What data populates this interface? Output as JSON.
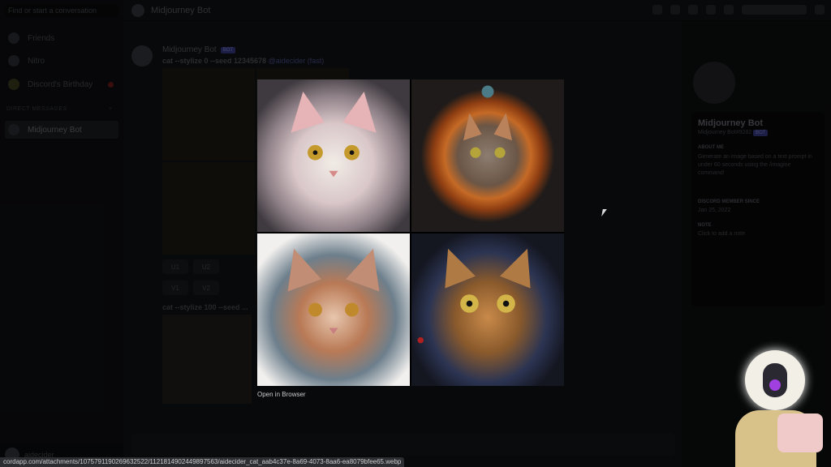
{
  "sidebar": {
    "search_placeholder": "Find or start a conversation",
    "items": [
      {
        "label": "Friends"
      },
      {
        "label": "Nitro"
      },
      {
        "label": "Discord's Birthday"
      }
    ],
    "dm_header": "DIRECT MESSAGES",
    "dm_add": "+",
    "dms": [
      {
        "label": "Midjourney Bot"
      }
    ],
    "user": "aidecider"
  },
  "header": {
    "title": "Midjourney Bot"
  },
  "chat": {
    "author": "Midjourney Bot",
    "bot_badge": "BOT",
    "prompt1": "cat --stylize 0 --seed 12345678",
    "mention": "@aidecider (fast)",
    "buttons_u": [
      "U1",
      "U2"
    ],
    "buttons_v": [
      "V1",
      "V2"
    ],
    "prompt2": "cat --stylize 100 --seed ..."
  },
  "profile": {
    "name": "Midjourney Bot",
    "tag": "Midjourney Bot#9282",
    "badge": "BOT",
    "about_label": "ABOUT ME",
    "about": "Generate an image based on a text prompt in under 60 seconds using the /imagine command!",
    "member_label": "DISCORD MEMBER SINCE",
    "member_since": "Jan 25, 2022",
    "note_label": "NOTE",
    "note_placeholder": "Click to add a note"
  },
  "lightbox": {
    "open_label": "Open in Browser",
    "images": [
      "Fluffy white cat",
      "Cat in orange steampunk frame",
      "Cat with ornate mechanical fur",
      "Tabby cat on dark splatter background"
    ]
  },
  "status_url": "cordapp.com/attachments/1075791190269632522/1121814902449897563/aidecider_cat_aab4c37e-8a69-4073-8aa6-ea8079bfee65.webp"
}
